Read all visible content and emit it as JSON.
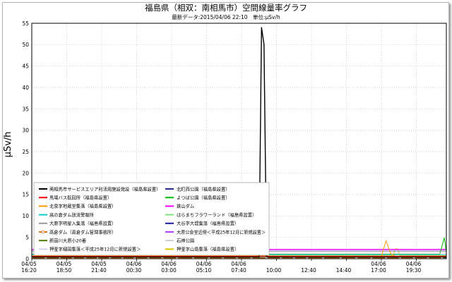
{
  "chart_data": {
    "type": "line",
    "title": "福島県（相双：南相馬市）空間線量率グラフ",
    "subtitle": "最新データ:2015/04/06 22:10　単位:μSv/h",
    "xlabel": "",
    "ylabel": "μSv/h",
    "ylim": [
      0,
      55
    ],
    "y_ticks": [
      0,
      5,
      10,
      15,
      20,
      25,
      30,
      35,
      40,
      45,
      50,
      55
    ],
    "x_ticks": [
      {
        "date": "04/05",
        "time": "16:20"
      },
      {
        "date": "04/05",
        "time": "18:50"
      },
      {
        "date": "04/05",
        "time": "21:40"
      },
      {
        "date": "04/06",
        "time": "00:30"
      },
      {
        "date": "04/06",
        "time": "03:00"
      },
      {
        "date": "04/06",
        "time": "05:10"
      },
      {
        "date": "04/06",
        "time": "07:40"
      },
      {
        "date": "",
        "time": "10:00"
      },
      {
        "date": "",
        "time": "12:40"
      },
      {
        "date": "",
        "time": "14:40"
      },
      {
        "date": "04/06",
        "time": "17:00"
      },
      {
        "date": "04/06",
        "time": "19:30"
      }
    ],
    "grid": true,
    "legend_position": "bottom-left",
    "series": [
      {
        "name": "南相馬市サービスエリア利活用施設発設（福島県設置）",
        "color": "#000000",
        "points": [
          [
            "04/05 16:20",
            0.4
          ],
          [
            "04/06 08:50",
            0.4
          ],
          [
            "04/06 09:00",
            54.0
          ],
          [
            "04/06 09:10",
            50.1
          ],
          [
            "04/06 09:20",
            0.4
          ],
          [
            "04/06 21:40",
            0.4
          ]
        ]
      },
      {
        "name": "馬場バス転回所（福島県設置）",
        "color": "#ff0000",
        "points": [
          [
            "04/05 16:20",
            0.6
          ],
          [
            "04/06 21:40",
            0.6
          ]
        ]
      },
      {
        "name": "北泉字地蔵堂集落（福島県設置）",
        "color": "#ff9900",
        "points": [
          [
            "04/05 16:20",
            0.6
          ],
          [
            "04/06 17:00",
            0.6
          ],
          [
            "04/06 17:20",
            4.2
          ],
          [
            "04/06 17:40",
            1.2
          ],
          [
            "04/06 18:00",
            0.6
          ],
          [
            "04/06 21:40",
            0.6
          ]
        ]
      },
      {
        "name": "高の倉ダム放流警報所",
        "color": "#00cccc",
        "points": [
          [
            "04/05 16:20",
            0.9
          ],
          [
            "04/06 21:40",
            0.9
          ]
        ]
      },
      {
        "name": "大原字明星入集落（福島県設置）",
        "color": "#999999",
        "points": [
          [
            "04/05 16:20",
            1.7
          ],
          [
            "04/06 21:40",
            1.7
          ]
        ]
      },
      {
        "name": "高倉ダム（高倉ダム管理事務所）",
        "color": "#e07820",
        "marker": "circle",
        "points": [
          [
            "04/05 16:20",
            0.15
          ],
          [
            "04/05 17:20",
            0.15
          ],
          [
            "04/05 18:20",
            0.15
          ],
          [
            "04/05 19:20",
            0.15
          ],
          [
            "04/05 20:20",
            0.15
          ],
          [
            "04/05 21:20",
            0.15
          ],
          [
            "04/05 22:20",
            0.15
          ],
          [
            "04/05 23:20",
            0.15
          ],
          [
            "04/06 00:20",
            0.15
          ],
          [
            "04/06 01:20",
            0.15
          ],
          [
            "04/06 02:20",
            0.15
          ],
          [
            "04/06 03:20",
            0.15
          ],
          [
            "04/06 04:20",
            0.15
          ],
          [
            "04/06 05:20",
            0.15
          ],
          [
            "04/06 06:20",
            0.15
          ],
          [
            "04/06 07:20",
            0.15
          ],
          [
            "04/06 08:20",
            0.15
          ],
          [
            "04/06 09:20",
            0.15
          ],
          [
            "04/06 10:20",
            0.15
          ],
          [
            "04/06 11:20",
            0.15
          ],
          [
            "04/06 12:20",
            0.15
          ],
          [
            "04/06 13:20",
            0.15
          ],
          [
            "04/06 14:20",
            0.15
          ],
          [
            "04/06 15:20",
            0.15
          ],
          [
            "04/06 16:20",
            0.15
          ],
          [
            "04/06 17:20",
            0.15
          ],
          [
            "04/06 18:20",
            0.15
          ],
          [
            "04/06 19:20",
            0.15
          ],
          [
            "04/06 20:20",
            0.15
          ],
          [
            "04/06 21:20",
            0.15
          ]
        ]
      },
      {
        "name": "新田川大原小20番",
        "color": "#557a00",
        "points": [
          [
            "04/05 16:20",
            0.3
          ],
          [
            "04/06 21:40",
            0.3
          ]
        ]
      },
      {
        "name": "押釜字細田集落＜平成25年12月に新規設置＞",
        "color": "#d0d0e8",
        "points": [
          [
            "04/05 16:20",
            1.2
          ],
          [
            "04/06 21:40",
            1.2
          ]
        ]
      },
      {
        "name": "北町西公園（福島県設置）",
        "color": "#2a2a8a",
        "points": [
          [
            "04/05 16:20",
            0.2
          ],
          [
            "04/06 21:40",
            0.2
          ]
        ]
      },
      {
        "name": "よつば公園（福島県設置）",
        "color": "#00bb00",
        "points": [
          [
            "04/05 16:20",
            1.0
          ],
          [
            "04/06 21:10",
            1.0
          ],
          [
            "04/06 21:30",
            4.9
          ],
          [
            "04/06 21:40",
            1.1
          ]
        ]
      },
      {
        "name": "鉄山ダム",
        "color": "#ff00ff",
        "points": [
          [
            "04/05 16:20",
            2.2
          ],
          [
            "04/06 21:40",
            2.2
          ]
        ]
      },
      {
        "name": "はらまちフラワーランド（福島県設置）",
        "color": "#7fe07f",
        "points": [
          [
            "04/05 16:20",
            0.25
          ],
          [
            "04/06 21:40",
            0.25
          ]
        ]
      },
      {
        "name": "大谷字大堤集落（福島県設置）",
        "color": "#1a1aa0",
        "points": [
          [
            "04/05 16:20",
            0.35
          ],
          [
            "04/06 21:40",
            0.35
          ]
        ]
      },
      {
        "name": "大原公会堂近傍＜平成25年12月に新規設置＞",
        "color": "#b040ff",
        "points": [
          [
            "04/05 16:20",
            2.0
          ],
          [
            "04/06 21:40",
            2.0
          ]
        ]
      },
      {
        "name": "石神公園",
        "color": "#cccccc",
        "points": [
          [
            "04/05 16:20",
            0.5
          ],
          [
            "04/06 21:40",
            0.5
          ]
        ]
      },
      {
        "name": "押釜字山島集落（福島県設置）",
        "color": "#d4c400",
        "points": [
          [
            "04/05 16:20",
            0.7
          ],
          [
            "04/06 17:50",
            0.7
          ],
          [
            "04/06 18:00",
            2.3
          ],
          [
            "04/06 18:10",
            2.3
          ],
          [
            "04/06 18:20",
            0.7
          ],
          [
            "04/06 21:40",
            0.7
          ]
        ]
      }
    ]
  }
}
